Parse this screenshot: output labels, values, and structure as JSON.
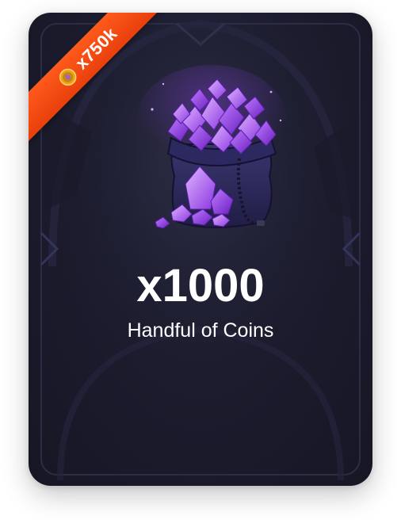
{
  "product": {
    "amount": "x1000",
    "name": "Handful of Coins",
    "image_icon": "gem-bag-icon"
  },
  "badge": {
    "label": "x750k",
    "icon": "coin-icon"
  },
  "colors": {
    "card_background": "#1c1c2e",
    "ribbon": "#f04a14",
    "gem": "#a45cf2",
    "text": "#ffffff"
  }
}
